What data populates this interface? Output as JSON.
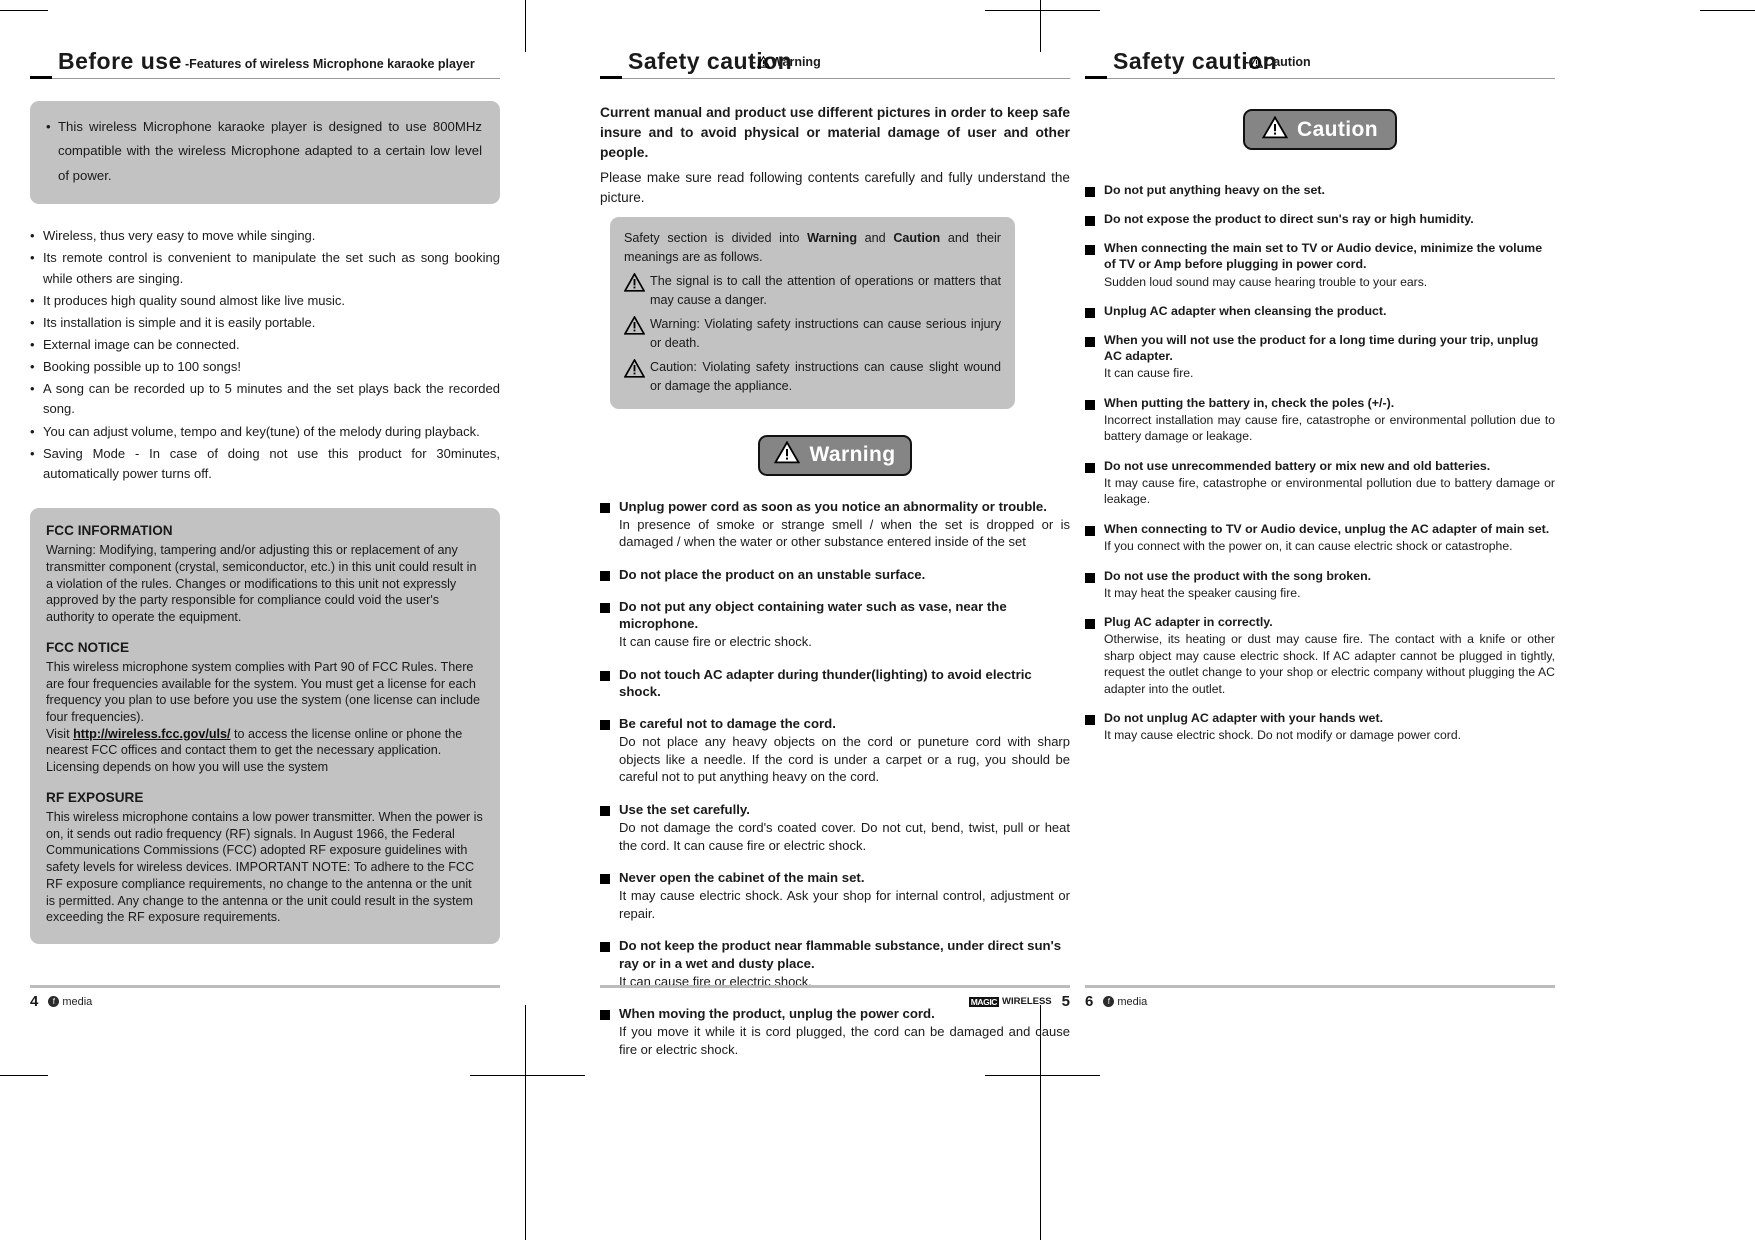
{
  "left_page": {
    "header": {
      "title": "Before  use",
      "subtitle": "-Features  of  wireless  Microphone  karaoke  player"
    },
    "intro_box": "This  wireless  Microphone  karaoke  player  is  designed  to  use  800MHz  compatible  with  the  wireless  Microphone  adapted  to  a  certain  low  level  of  power.",
    "features": [
      "Wireless,  thus  very  easy  to  move  while  singing.",
      "Its  remote  control  is  convenient  to  manipulate  the  set  such  as  song  booking  while  others  are  singing.",
      "It  produces  high  quality  sound  almost  like  live  music.",
      "Its  installation  is  simple  and  it  is  easily  portable.",
      "External  image  can  be  connected.",
      "Booking  possible  up  to  100  songs!",
      "A  song  can  be  recorded  up  to  5  minutes  and  the  set  plays  back  the  recorded  song.",
      "You  can  adjust  volume,  tempo  and  key(tune)  of  the  melody  during  playback.",
      "Saving  Mode  -  In  case  of  doing  not  use  this  product  for  30minutes,  automatically  power  turns  off."
    ],
    "fcc": {
      "information_heading": "FCC INFORMATION",
      "information_body": "Warning: Modifying, tampering and/or adjusting this or replacement of any transmitter component (crystal, semiconductor, etc.) in this unit could result in a violation of the rules. Changes or modifications to this unit not expressly approved by the party responsible for compliance could void the user's authority to operate the equipment.",
      "notice_heading": "FCC NOTICE",
      "notice_body_1": "This wireless microphone system complies with Part 90 of FCC Rules. There are four frequencies available for the system. You must get a license for each frequency you plan to use before you use the system (one license can include four frequencies).",
      "notice_visit_prefix": "Visit ",
      "notice_link": "http://wireless.fcc.gov/uls/",
      "notice_visit_suffix": " to access the license online or phone the nearest FCC offices and contact them to get the necessary application. Licensing depends on how you will use the system",
      "rf_heading": "RF EXPOSURE",
      "rf_body": "This wireless microphone contains a low power transmitter. When the power is on, it sends out radio frequency (RF) signals. In August 1966, the Federal Communications Commissions (FCC) adopted RF exposure guidelines with safety levels for wireless devices. IMPORTANT NOTE: To adhere to the FCC RF exposure compliance requirements, no change to the antenna or the unit is permitted. Any change to the antenna or the unit could result in the system exceeding the RF exposure requirements."
    },
    "footer": {
      "page_number": "4",
      "logo": "media"
    }
  },
  "mid_page": {
    "header": {
      "title": "Safety  caution",
      "subtitle_prefix": "-",
      "subtitle": "Warning"
    },
    "intro_bold": "Current  manual  and  product  use  different  pictures  in  order  to  keep  safe  insure  and  to  avoid  physical  or  material  damage  of  user  and  other  people.",
    "intro_plain": "Please  make  sure  read  following  contents  carefully  and  fully  understand  the  picture.",
    "meaning_box": {
      "lead_1": "Safety  section  is  divided  into  ",
      "lead_bold_1": "Warning",
      "lead_2": "  and  ",
      "lead_bold_2": "Caution",
      "lead_3": "  and  their  meanings  are  as  follows.",
      "rows": [
        "The  signal  is  to  call  the  attention  of  operations  or  matters  that  may  cause  a  danger.",
        "Warning:  Violating  safety  instructions  can  cause  serious  injury  or  death.",
        "Caution:  Violating  safety  instructions  can  cause  slight  wound  or  damage  the  appliance."
      ]
    },
    "badge_label": "Warning",
    "items": [
      {
        "title": "Unplug power cord as soon as you notice an abnormality or trouble.",
        "desc": "In  presence  of  smoke  or  strange  smell  /  when  the  set  is  dropped  or  is  damaged  /  when  the  water  or  other  substance  entered  inside  of  the  set"
      },
      {
        "title": "Do not place the product on an unstable surface.",
        "desc": ""
      },
      {
        "title": "Do not put any object containing water such as vase, near the microphone.",
        "desc": "It  can  cause  fire  or  electric  shock."
      },
      {
        "title": "Do not touch AC adapter during thunder(lighting) to avoid electric shock.",
        "desc": ""
      },
      {
        "title": "Be careful not to damage the cord.",
        "desc": "Do  not  place  any  heavy  objects  on  the  cord  or  puneture  cord  with  sharp  objects  like  a  needle.  If  the  cord  is  under  a  carpet  or  a  rug,  you  should  be  careful  not  to  put  anything  heavy  on  the  cord."
      },
      {
        "title": "Use the set carefully.",
        "desc": "Do  not  damage  the  cord's  coated  cover.  Do  not  cut,  bend,  twist,  pull  or  heat  the  cord.  It  can  cause  fire  or  electric  shock."
      },
      {
        "title": "Never open the cabinet of the main set.",
        "desc": "It  may  cause  electric  shock.  Ask  your  shop  for  internal  control,  adjustment  or  repair."
      },
      {
        "title": "Do not keep the product near flammable substance, under direct sun's ray or in a wet and dusty place.",
        "desc": "It  can  cause  fire  or  electric  shock."
      },
      {
        "title": "When moving the product, unplug the power cord.",
        "desc": "If  you  move  it  while  it  is  cord  plugged,  the  cord  can  be  damaged  and  cause  fire  or  electric  shock."
      }
    ],
    "footer": {
      "page_number": "5",
      "logo_magic": "MAGIC",
      "logo_wireless": "WIRELESS"
    }
  },
  "right_page": {
    "header": {
      "title": "Safety  caution",
      "subtitle_prefix": "-",
      "subtitle": "Caution"
    },
    "badge_label": "Caution",
    "items": [
      {
        "title": "Do not put anything heavy on the set.",
        "desc": ""
      },
      {
        "title": "Do not expose the product to direct sun's ray or high humidity.",
        "desc": ""
      },
      {
        "title": "When connecting the main set to TV or Audio device, minimize the volume of TV or Amp before plugging in power cord.",
        "desc": "Sudden loud sound may cause hearing trouble to your ears."
      },
      {
        "title": "Unplug AC adapter when cleansing the product.",
        "desc": ""
      },
      {
        "title": "When you will not use the product for a long time during your trip, unplug AC adapter.",
        "desc": "It  can  cause  fire."
      },
      {
        "title": "When  putting  the  battery  in,  check  the  poles  (+/-).",
        "desc": "Incorrect  installation  may  cause  fire,  catastrophe  or  environmental  pollution  due  to  battery  damage  or  leakage."
      },
      {
        "title": "Do  not  use  unrecommended  battery  or  mix  new  and  old  batteries.",
        "desc": "It  may  cause  fire,  catastrophe  or  environmental  pollution  due  to  battery  damage  or  leakage."
      },
      {
        "title": "When  connecting  to  TV  or  Audio  device,  unplug  the  AC  adapter  of  main  set.",
        "desc": "If  you  connect  with  the  power  on,  it  can  cause  electric  shock  or  catastrophe."
      },
      {
        "title": "Do  not  use  the  product  with  the  song  broken.",
        "desc": "It  may  heat  the  speaker  causing  fire."
      },
      {
        "title": "Plug  AC  adapter  in  correctly.",
        "desc": "Otherwise,  its  heating  or  dust  may  cause  fire.  The  contact  with  a  knife  or  other  sharp  object  may  cause  electric  shock.  If  AC  adapter  cannot  be  plugged  in  tightly,  request  the  outlet  change  to  your  shop  or  electric  company  without  plugging  the  AC  adapter  into  the  outlet."
      },
      {
        "title": "Do  not  unplug  AC  adapter  with  your  hands  wet.",
        "desc": "It  may  cause  electric  shock.  Do  not  modify  or  damage  power  cord."
      }
    ],
    "footer": {
      "page_number": "6",
      "logo": "media"
    }
  },
  "colors": {
    "grey_box": "#c2c2c2",
    "badge_fill": "#858585",
    "rule": "#bcbcbc"
  }
}
